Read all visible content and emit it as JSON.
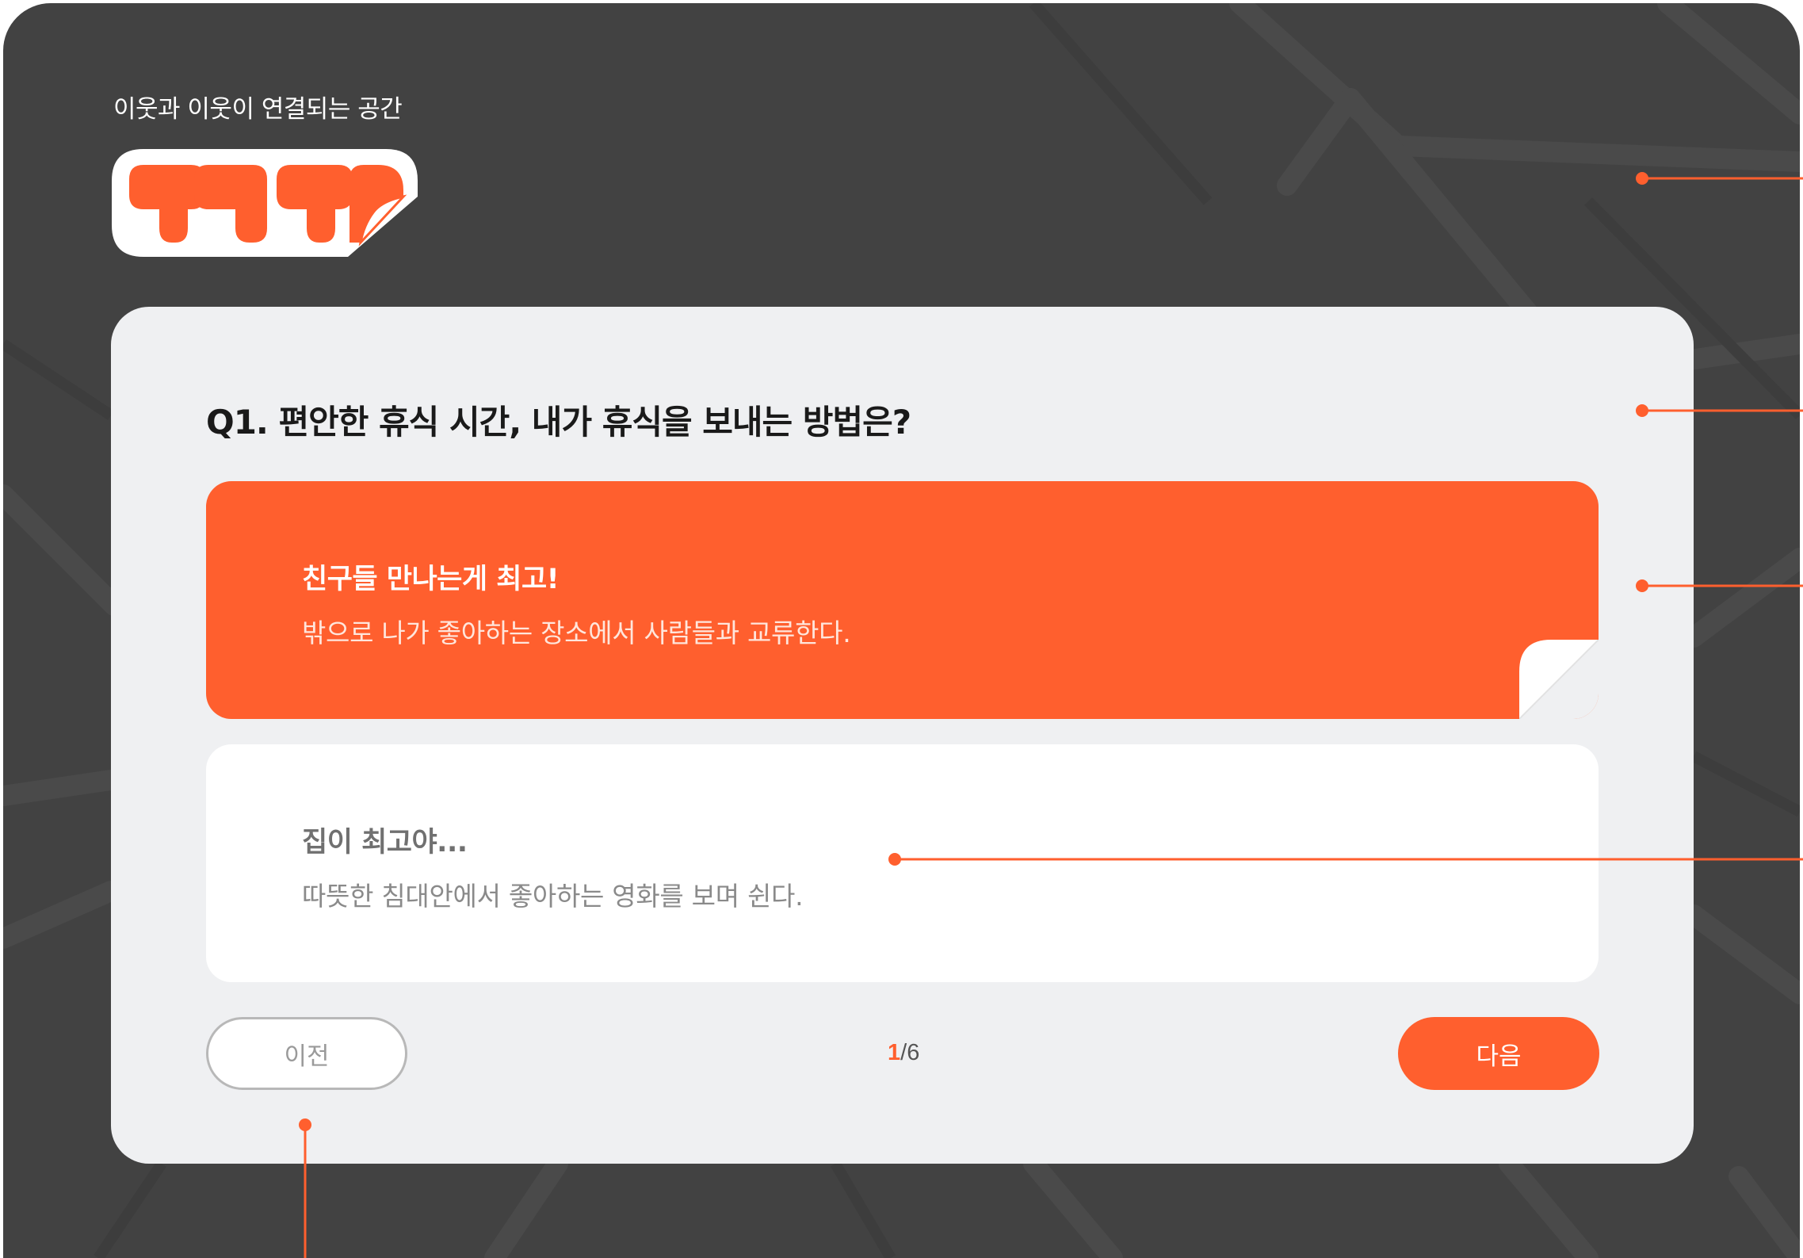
{
  "header": {
    "tagline": "이웃과 이웃이 연결되는 공간",
    "logo_icon": "sticker-logo-icon"
  },
  "quiz": {
    "question": "Q1. 편안한 휴식 시간, 내가 휴식을 보내는 방법은?",
    "options": [
      {
        "title": "친구들 만나는게 최고!",
        "description": "밖으로 나가 좋아하는 장소에서 사람들과 교류한다.",
        "selected": true
      },
      {
        "title": "집이 최고야...",
        "description": "따뜻한 침대안에서 좋아하는 영화를 보며 쉰다.",
        "selected": false
      }
    ],
    "prev_label": "이전",
    "next_label": "다음",
    "progress_current": "1",
    "progress_total": "/6"
  },
  "colors": {
    "accent": "#ff5f2e",
    "background": "#424242",
    "card": "#eff0f2"
  }
}
